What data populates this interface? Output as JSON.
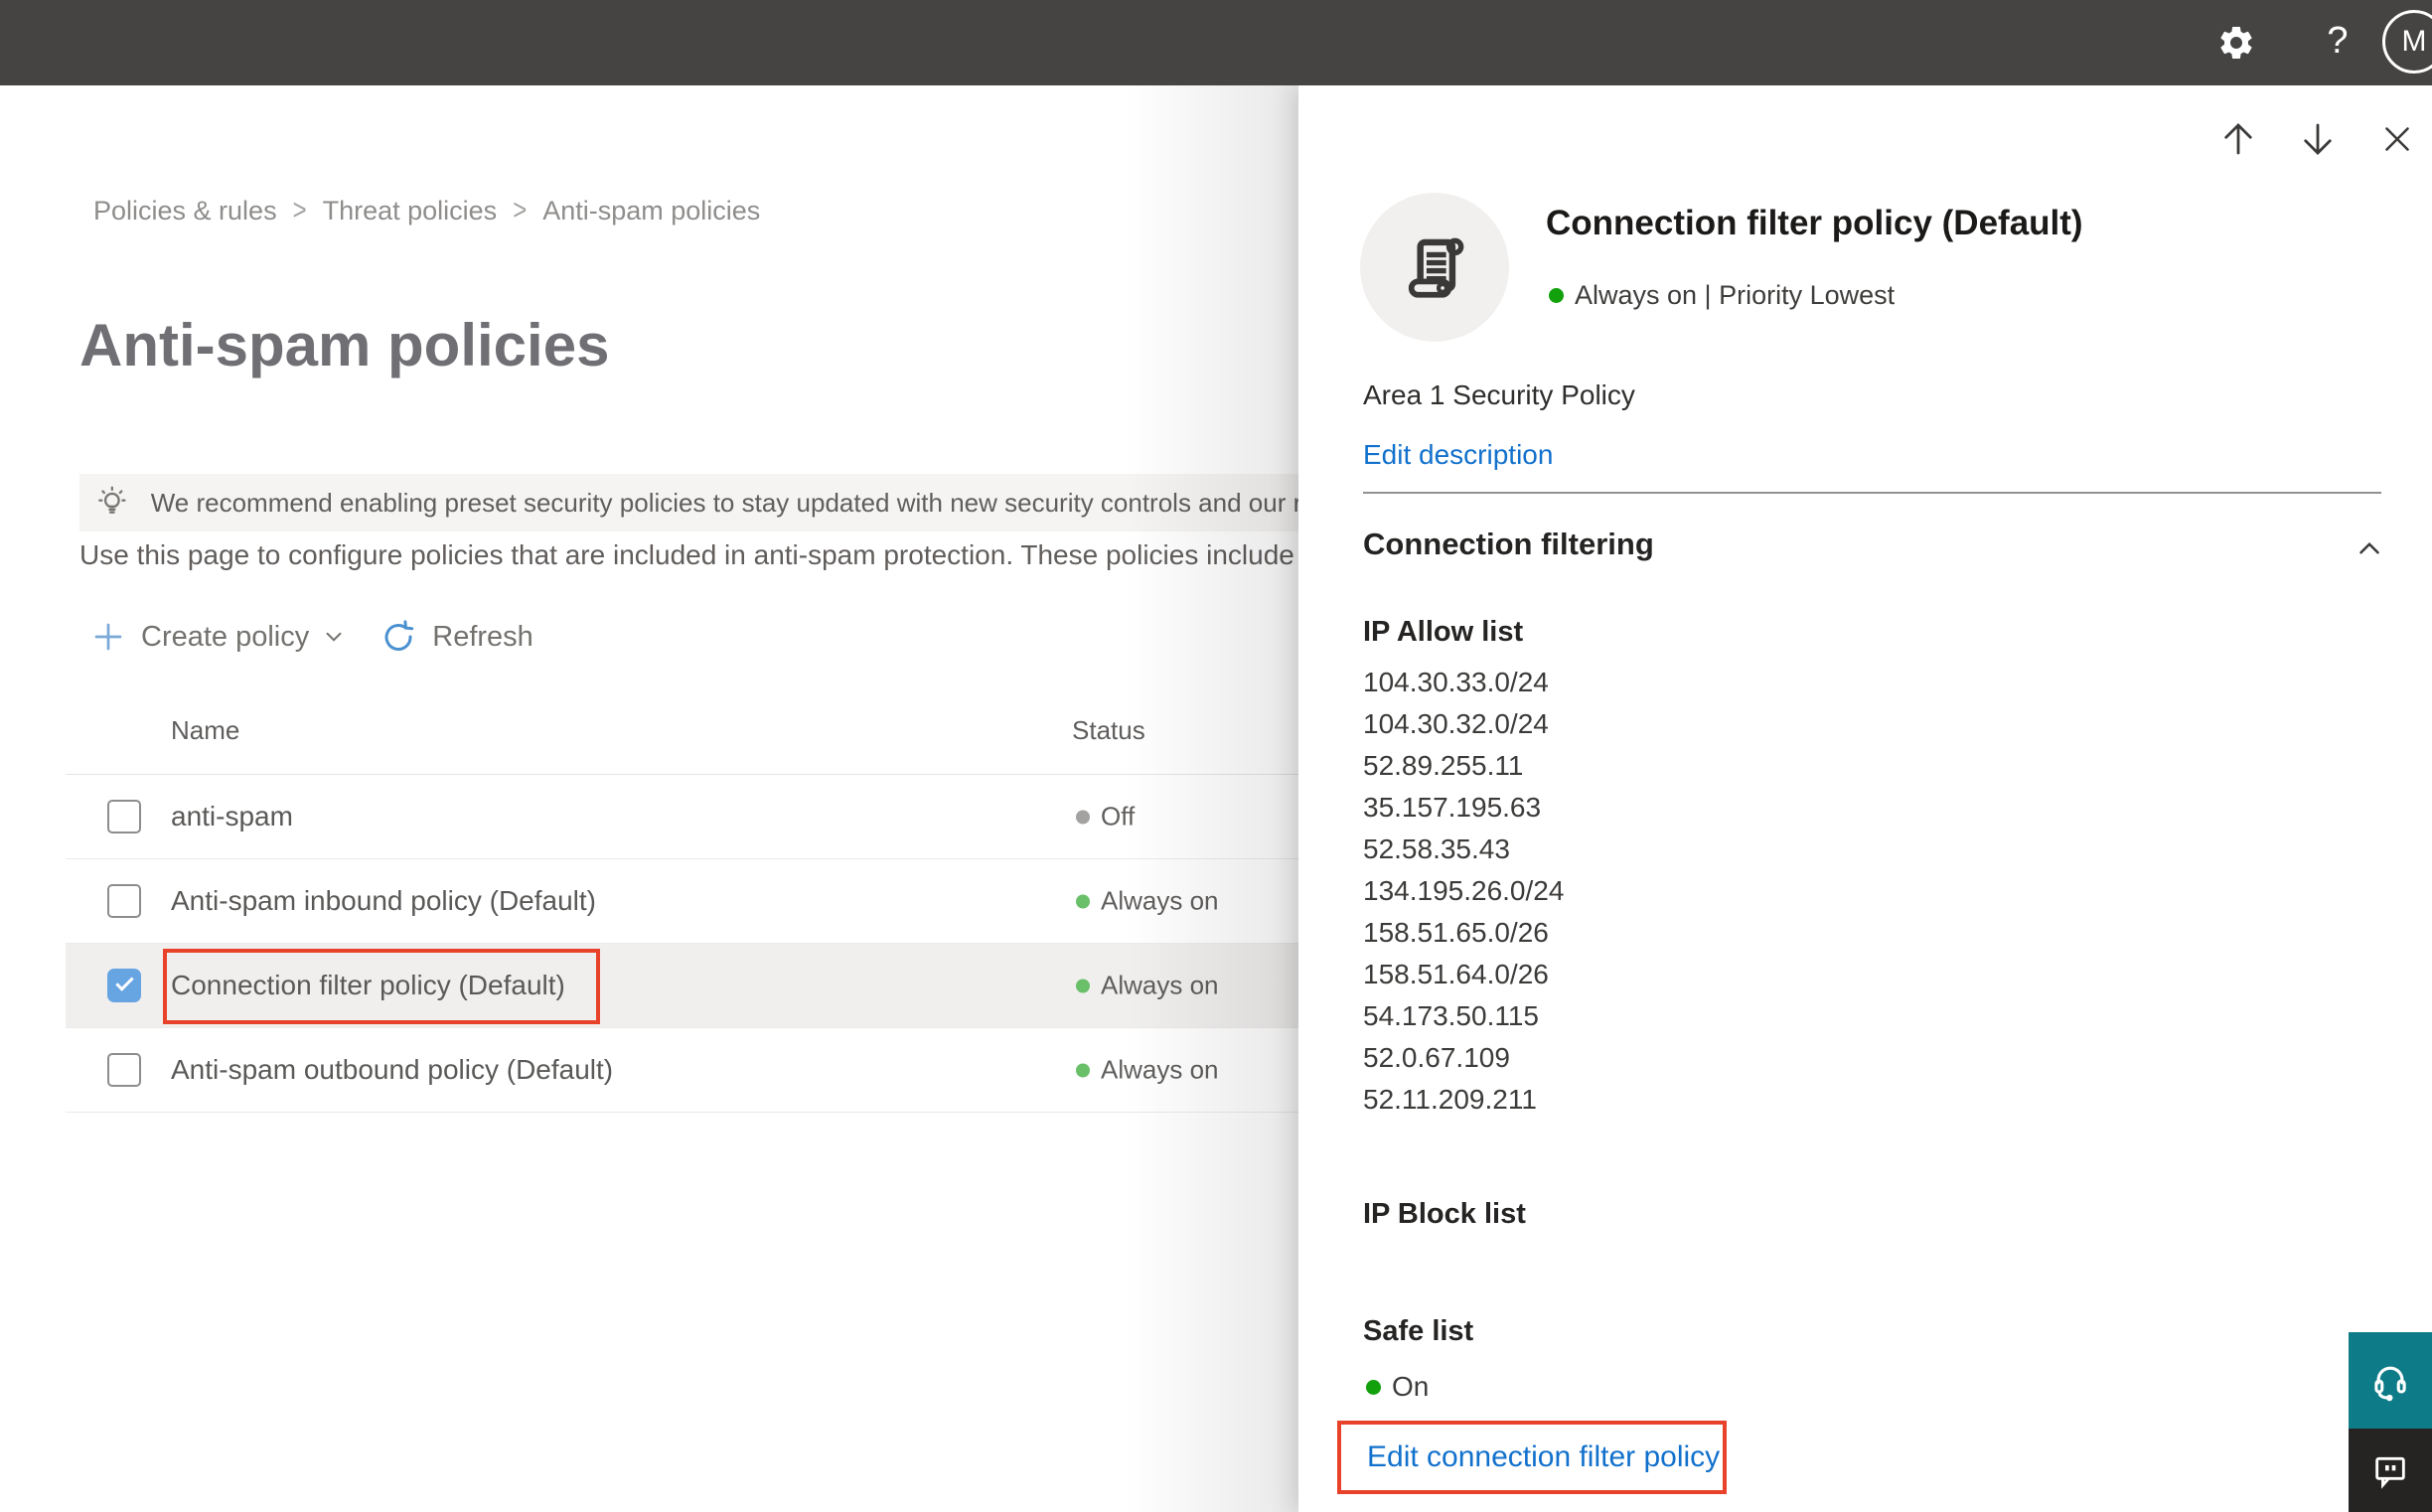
{
  "topbar": {
    "help_label": "?",
    "avatar_initial": "M"
  },
  "breadcrumb": {
    "items": [
      "Policies & rules",
      "Threat policies",
      "Anti-spam policies"
    ]
  },
  "page": {
    "title": "Anti-spam policies",
    "banner_text": "We recommend enabling preset security policies to stay updated with new security controls and our recomme",
    "description": "Use this page to configure policies that are included in anti-spam protection. These policies include",
    "toolbar": {
      "create_label": "Create policy",
      "refresh_label": "Refresh"
    }
  },
  "table": {
    "columns": [
      "Name",
      "Status"
    ],
    "rows": [
      {
        "name": "anti-spam",
        "status": "Off",
        "status_color": "#a3a2a0",
        "checked": false,
        "selected": false,
        "outlined": false
      },
      {
        "name": "Anti-spam inbound policy (Default)",
        "status": "Always on",
        "status_color": "#6abf69",
        "checked": false,
        "selected": false,
        "outlined": false
      },
      {
        "name": "Connection filter policy (Default)",
        "status": "Always on",
        "status_color": "#6abf69",
        "checked": true,
        "selected": true,
        "outlined": true
      },
      {
        "name": "Anti-spam outbound policy (Default)",
        "status": "Always on",
        "status_color": "#6abf69",
        "checked": false,
        "selected": false,
        "outlined": false
      }
    ]
  },
  "panel": {
    "title": "Connection filter policy (Default)",
    "status_text": "Always on | Priority Lowest",
    "status_color": "#12a10d",
    "description": "Area 1 Security Policy",
    "edit_description_label": "Edit description",
    "section_title": "Connection filtering",
    "ip_allow_title": "IP Allow list",
    "ip_allow_items": [
      "104.30.33.0/24",
      "104.30.32.0/24",
      "52.89.255.11",
      "35.157.195.63",
      "52.58.35.43",
      "134.195.26.0/24",
      "158.51.65.0/26",
      "158.51.64.0/26",
      "54.173.50.115",
      "52.0.67.109",
      "52.11.209.211"
    ],
    "ip_block_title": "IP Block list",
    "safe_list_title": "Safe list",
    "safe_list_status": "On",
    "edit_policy_label": "Edit connection filter policy"
  },
  "colors": {
    "accent_blue": "#1271cc",
    "highlight_red": "#e8432a",
    "checkbox_blue": "#67a5e2",
    "status_green": "#6abf69",
    "panel_green": "#12a10d",
    "status_gray": "#a3a2a0",
    "support_teal": "#0e7b88",
    "topbar_dark": "#454442"
  }
}
